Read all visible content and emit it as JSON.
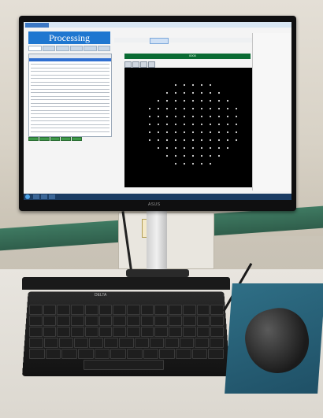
{
  "app": {
    "title": "Processing",
    "status_green_bar": "0000"
  },
  "monitor": {
    "brand": "ASUS"
  },
  "keyboard": {
    "brand": "DELTA"
  },
  "taskbar": {
    "clock": ""
  },
  "colors": {
    "accent": "#1f77d0",
    "wafer_background": "#000000",
    "status_bar": "#0a6b33",
    "button_green": "#3e9a4a",
    "mousepad": "#2f6f86"
  }
}
